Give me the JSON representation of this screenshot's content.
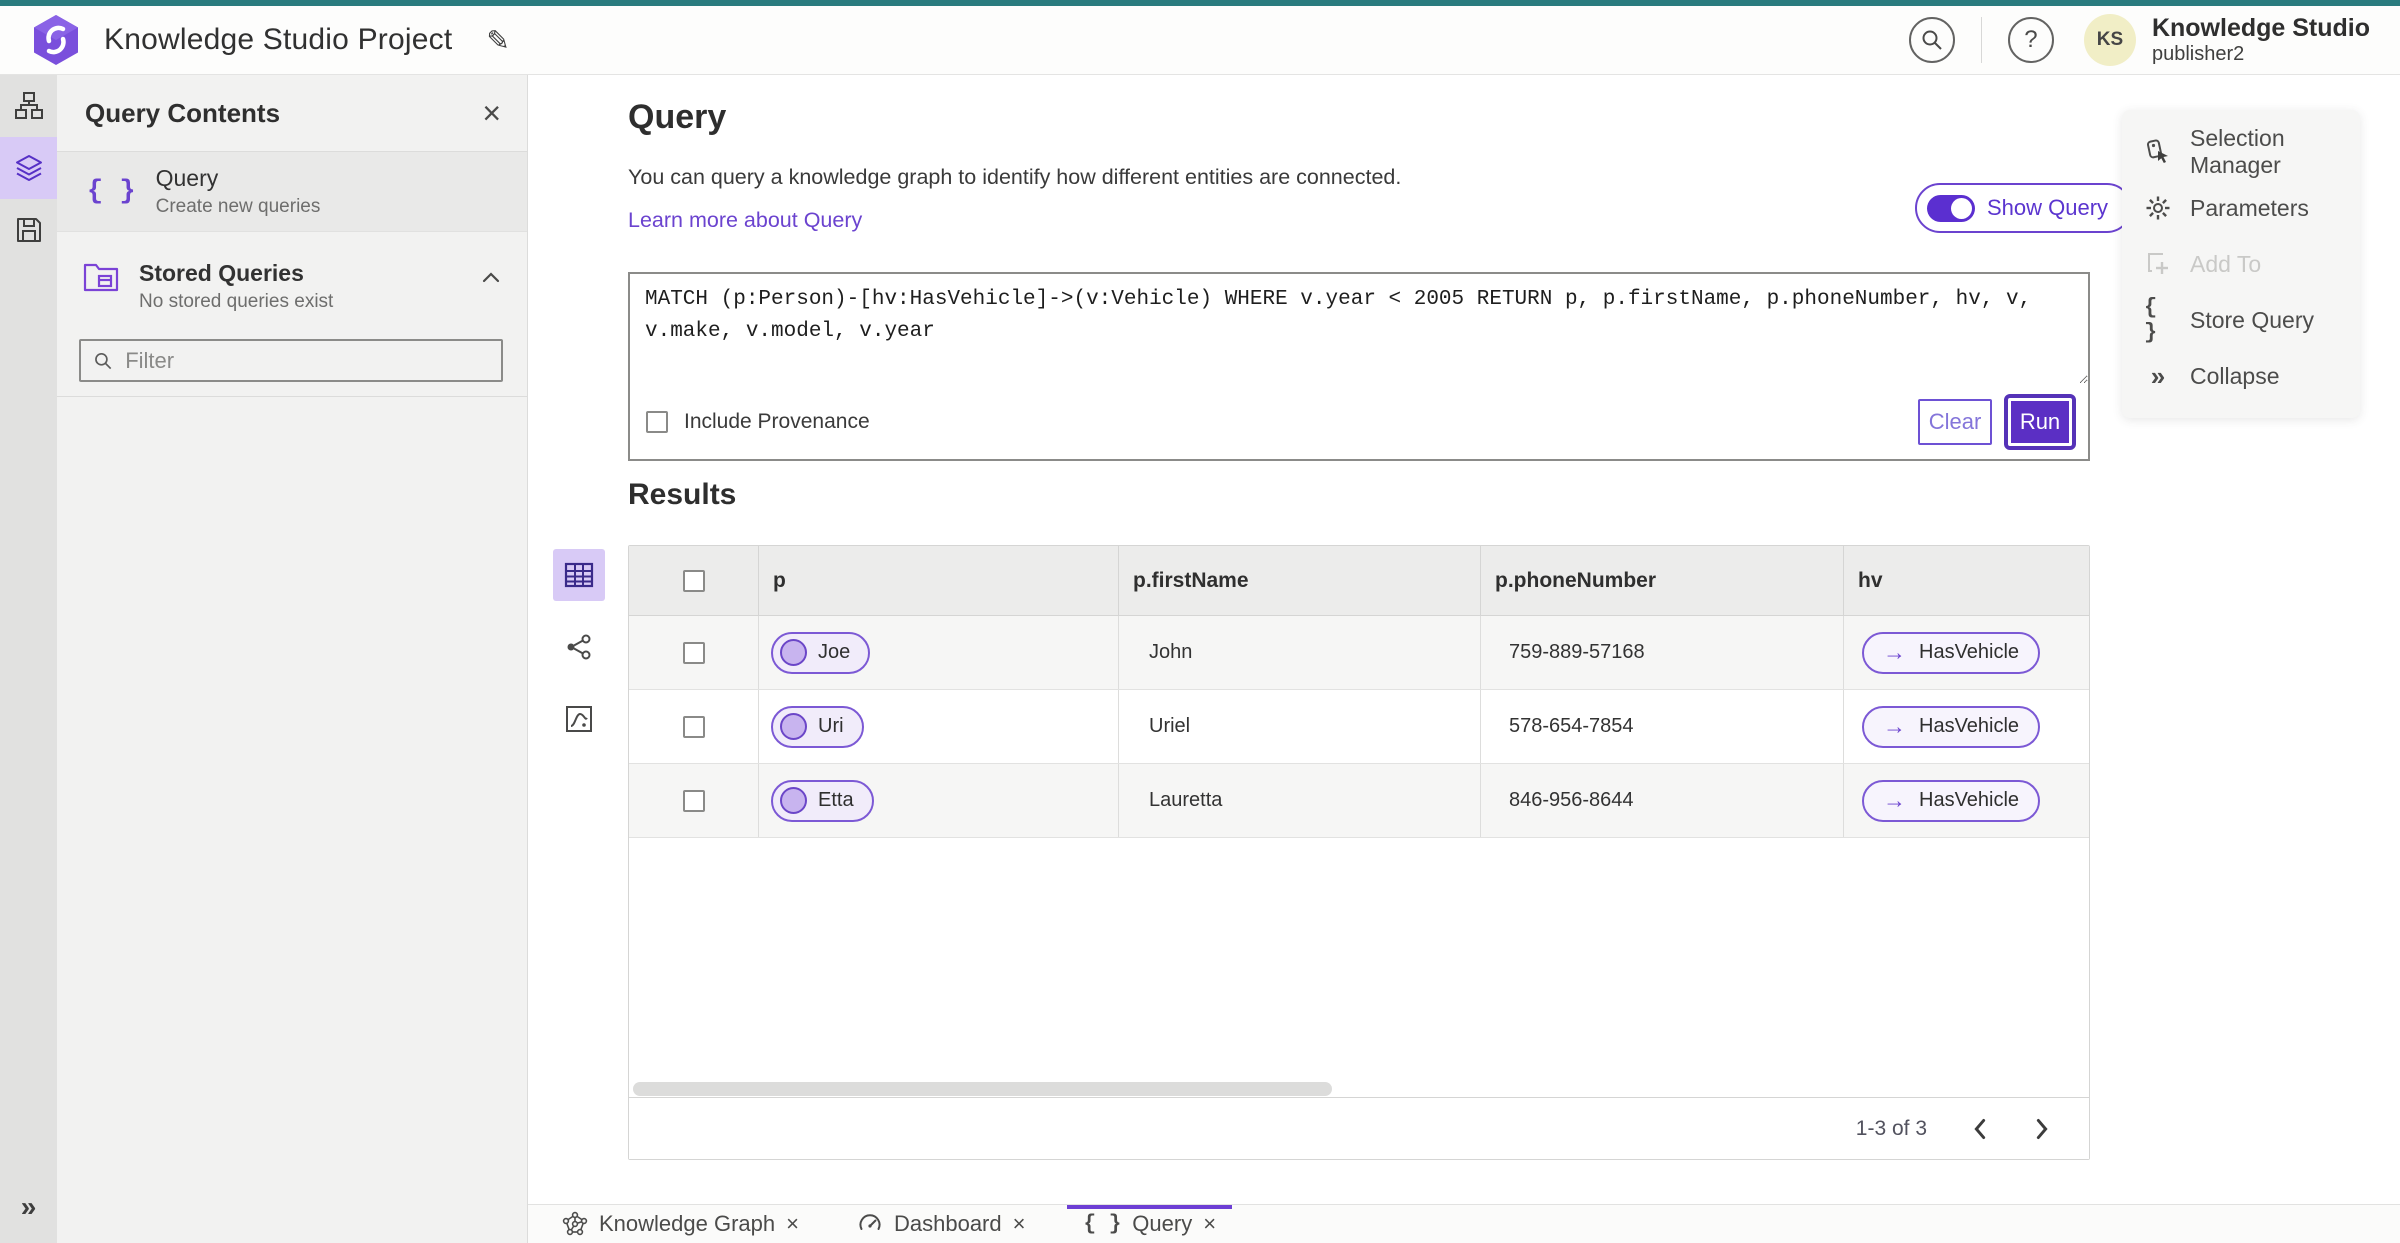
{
  "topbar": {
    "title": "Knowledge Studio Project",
    "user_name": "Knowledge Studio",
    "user_sub": "publisher2",
    "avatar_initials": "KS"
  },
  "sidebar": {
    "title": "Query Contents",
    "query_item": {
      "label": "Query",
      "sublabel": "Create new queries"
    },
    "stored_item": {
      "label": "Stored Queries",
      "sublabel": "No stored queries exist"
    },
    "filter_placeholder": "Filter"
  },
  "query_panel": {
    "heading": "Query",
    "description": "You can query a knowledge graph to identify how different entities are connected.",
    "learn_more": "Learn more about Query",
    "show_query_label": "Show Query",
    "query_text": "MATCH (p:Person)-[hv:HasVehicle]->(v:Vehicle) WHERE v.year < 2005 RETURN p, p.firstName, p.phoneNumber, hv, v, v.make, v.model, v.year",
    "include_provenance_label": "Include Provenance",
    "clear_label": "Clear",
    "run_label": "Run"
  },
  "results": {
    "heading": "Results",
    "columns": [
      "p",
      "p.firstName",
      "p.phoneNumber",
      "hv"
    ],
    "rows": [
      {
        "p": "Joe",
        "firstName": "John",
        "phoneNumber": "759-889-57168",
        "hv": "HasVehicle"
      },
      {
        "p": "Uri",
        "firstName": "Uriel",
        "phoneNumber": "578-654-7854",
        "hv": "HasVehicle"
      },
      {
        "p": "Etta",
        "firstName": "Lauretta",
        "phoneNumber": "846-956-8644",
        "hv": "HasVehicle"
      }
    ],
    "pagination": {
      "label": "1-3 of 3"
    }
  },
  "right_panel": {
    "items": [
      {
        "label": "Selection Manager"
      },
      {
        "label": "Parameters"
      },
      {
        "label": "Add To",
        "disabled": true
      },
      {
        "label": "Store Query"
      },
      {
        "label": "Collapse"
      }
    ]
  },
  "tabs": [
    {
      "label": "Knowledge Graph"
    },
    {
      "label": "Dashboard"
    },
    {
      "label": "Query",
      "active": true
    }
  ],
  "icons": {
    "close": "×",
    "edit_pencil": "✎",
    "help": "?",
    "braces": "{ }",
    "arrow_right": "→",
    "collapse_double": "»",
    "gear": "⚙"
  },
  "colors": {
    "accent_purple": "#6b43cf",
    "run_button": "#5b2fc4",
    "top_strip_teal": "#2a7b7e",
    "selected_highlight": "#d8caf6",
    "avatar_bg": "#f1eec6"
  }
}
